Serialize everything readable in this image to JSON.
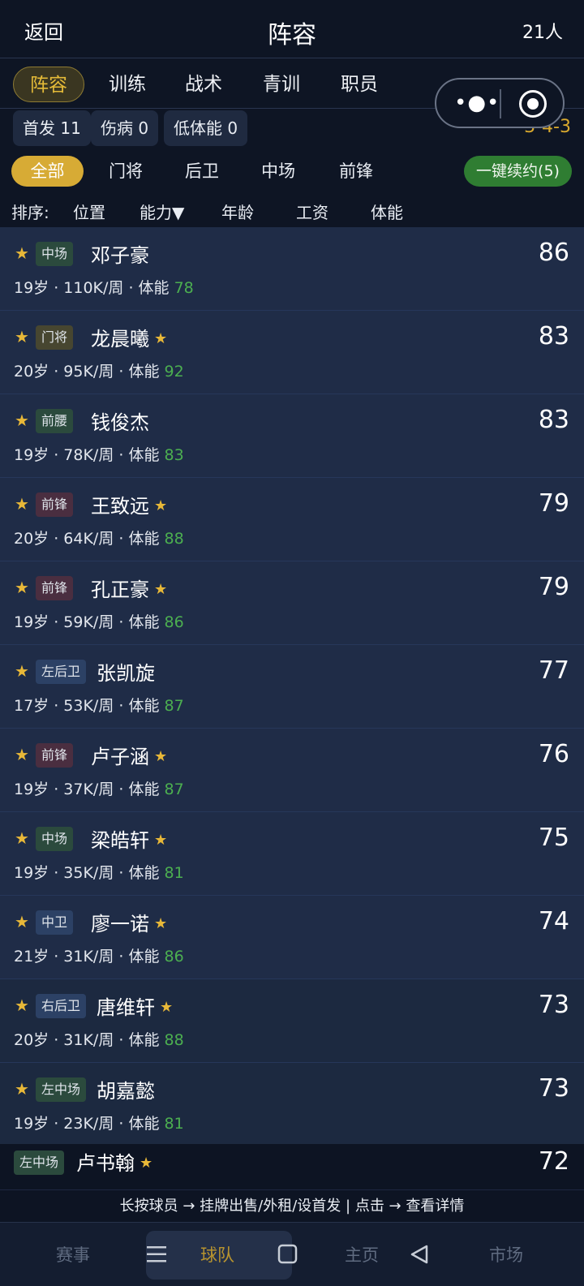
{
  "header": {
    "back_label": "返回",
    "title": "阵容",
    "count": "21人"
  },
  "tabs": [
    {
      "label": "阵容",
      "active": true
    },
    {
      "label": "训练"
    },
    {
      "label": "战术"
    },
    {
      "label": "青训"
    },
    {
      "label": "职员"
    }
  ],
  "capsule": {
    "more_icon": "more-dots-icon",
    "close_icon": "target-circle-icon"
  },
  "status": {
    "starters": "首发 11",
    "injured": "伤病 0",
    "low_stamina": "低体能 0",
    "formation": "3-4-3"
  },
  "filters": {
    "items": [
      {
        "label": "全部",
        "active": true
      },
      {
        "label": "门将"
      },
      {
        "label": "后卫"
      },
      {
        "label": "中场"
      },
      {
        "label": "前锋"
      }
    ],
    "renew_label": "一键续约(5)"
  },
  "sort": {
    "prefix": "排序:",
    "options": [
      "位置",
      "能力▼",
      "年龄",
      "工资",
      "体能"
    ]
  },
  "players": [
    {
      "position": "中场",
      "name": "邓子豪",
      "star": false,
      "rating": "86",
      "info": "19岁 · 110K/周 · 体能 ",
      "stamina": "78"
    },
    {
      "position": "门将",
      "name": "龙晨曦",
      "star": true,
      "rating": "83",
      "info": "20岁 · 95K/周 · 体能 ",
      "stamina": "92"
    },
    {
      "position": "前腰",
      "name": "钱俊杰",
      "star": false,
      "rating": "83",
      "info": "19岁 · 78K/周 · 体能 ",
      "stamina": "83"
    },
    {
      "position": "前锋",
      "name": "王致远",
      "star": true,
      "rating": "79",
      "info": "20岁 · 64K/周 · 体能 ",
      "stamina": "88"
    },
    {
      "position": "前锋",
      "name": "孔正豪",
      "star": true,
      "rating": "79",
      "info": "19岁 · 59K/周 · 体能 ",
      "stamina": "86"
    },
    {
      "position": "左后卫",
      "name": "张凯旋",
      "star": false,
      "rating": "77",
      "info": "17岁 · 53K/周 · 体能 ",
      "stamina": "87"
    },
    {
      "position": "前锋",
      "name": "卢子涵",
      "star": true,
      "rating": "76",
      "info": "19岁 · 37K/周 · 体能 ",
      "stamina": "87"
    },
    {
      "position": "中场",
      "name": "梁皓轩",
      "star": true,
      "rating": "75",
      "info": "19岁 · 35K/周 · 体能 ",
      "stamina": "81"
    },
    {
      "position": "中卫",
      "name": "廖一诺",
      "star": true,
      "rating": "74",
      "info": "21岁 · 31K/周 · 体能 ",
      "stamina": "86"
    },
    {
      "position": "右后卫",
      "name": "唐维轩",
      "star": true,
      "rating": "73",
      "info": "20岁 · 31K/周 · 体能 ",
      "stamina": "88"
    },
    {
      "position": "左中场",
      "name": "胡嘉懿",
      "star": false,
      "rating": "73",
      "info": "19岁 · 23K/周 · 体能 ",
      "stamina": "81"
    }
  ],
  "partial_player": {
    "position": "左中场",
    "name": "卢书翰",
    "star": true,
    "rating": "72"
  },
  "hint": "长按球员 → 挂牌出售/外租/设首发 | 点击 → 查看详情",
  "bottom_nav": [
    {
      "label": "赛事"
    },
    {
      "label": "球队",
      "active": true
    },
    {
      "label": "主页"
    },
    {
      "label": "市场"
    }
  ],
  "colors": {
    "accent_gold": "#d7ab35",
    "stamina_green": "#4caf50",
    "renew_green": "#2f7d32",
    "badge_midfield": "#2b4a3d",
    "badge_goalkeeper": "#474630",
    "badge_forward": "#4a2e40",
    "badge_defender": "#2c4165"
  }
}
